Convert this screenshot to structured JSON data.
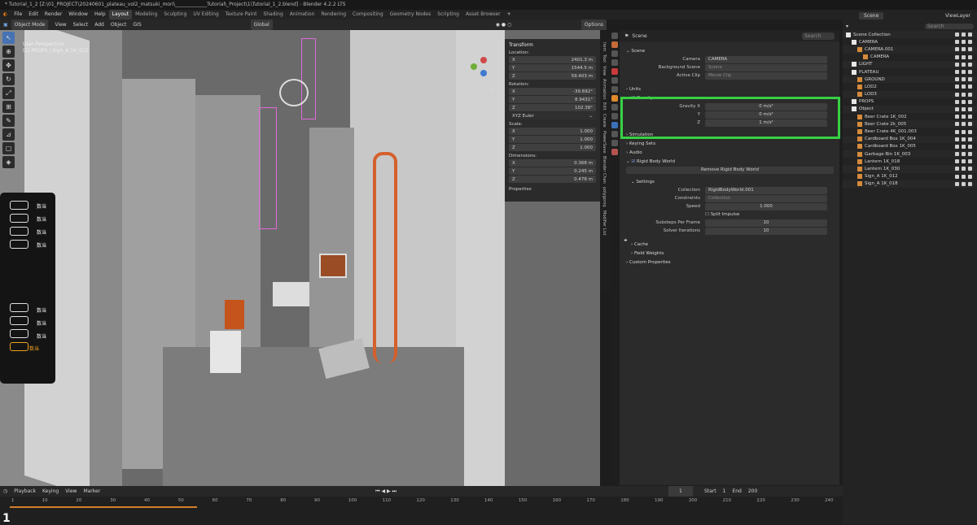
{
  "title": "* Tutorial_1_2 [Z:\\01_PROJECT\\20240601_plateau_vol2_matsuki_mori\\_____________Tutorial\\_Project\\1\\Tutorial_1_2.blend] - Blender 4.2.2 LTS",
  "menu": [
    "File",
    "Edit",
    "Render",
    "Window",
    "Help"
  ],
  "workspaces": [
    "Layout",
    "Modeling",
    "Sculpting",
    "UV Editing",
    "Texture Paint",
    "Shading",
    "Animation",
    "Rendering",
    "Compositing",
    "Geometry Nodes",
    "Scripting",
    "Asset Browser"
  ],
  "active_workspace": "Layout",
  "viewport_header": {
    "mode": "Object Mode",
    "items": [
      "View",
      "Select",
      "Add",
      "Object"
    ],
    "slot": "GIS",
    "orientation": "Global",
    "options": "Options"
  },
  "viewport": {
    "persp": "User Perspective",
    "selection": "(1) PROPS | Sign_A 1K_012"
  },
  "transform": {
    "title": "Transform",
    "location_label": "Location:",
    "location": [
      {
        "axis": "X",
        "value": "2401.3 m"
      },
      {
        "axis": "Y",
        "value": "1544.5 m"
      },
      {
        "axis": "Z",
        "value": "59.403 m"
      }
    ],
    "rotation_label": "Rotation:",
    "rotation": [
      {
        "axis": "X",
        "value": "-39.692°"
      },
      {
        "axis": "Y",
        "value": "8.9431°"
      },
      {
        "axis": "Z",
        "value": "102.38°"
      }
    ],
    "rotation_mode": "XYZ Euler",
    "scale_label": "Scale:",
    "scale": [
      {
        "axis": "X",
        "value": "1.000"
      },
      {
        "axis": "Y",
        "value": "1.000"
      },
      {
        "axis": "Z",
        "value": "1.000"
      }
    ],
    "dimensions_label": "Dimensions:",
    "dimensions": [
      {
        "axis": "X",
        "value": "0.368 m"
      },
      {
        "axis": "Y",
        "value": "0.245 m"
      },
      {
        "axis": "Z",
        "value": "0.478 m"
      }
    ],
    "properties": "Properties"
  },
  "ntabs": [
    "Item",
    "Tool",
    "View",
    "Animation",
    "Edit",
    "Create",
    "PowerSave",
    "Blender Chan",
    "polygoniq",
    "Modifier List"
  ],
  "overlay_labels": [
    "数当",
    "数当",
    "数当",
    "数当",
    "数当",
    "数当",
    "数当",
    "数当"
  ],
  "properties": {
    "search_placeholder": "Search",
    "scene": "Scene",
    "scene_section": "Scene",
    "camera_label": "Camera",
    "camera": "CAMERA",
    "bg_label": "Background Scene",
    "bg": "Scene",
    "clip_label": "Active Clip",
    "clip": "Movie Clip",
    "units": "Units",
    "gravity": "Gravity",
    "gx_label": "Gravity X",
    "gx": "0 m/s²",
    "gy_label": "Y",
    "gy": "0 m/s²",
    "gz_label": "Z",
    "gz": "1 m/s²",
    "simulation": "Simulation",
    "keying": "Keying Sets",
    "audio": "Audio",
    "rbw": "Rigid Body World",
    "remove_rbw": "Remove Rigid Body World",
    "settings": "Settings",
    "collection_label": "Collection",
    "collection": "RigidBodyWorld.001",
    "constraints_label": "Constraints",
    "constraints": "Collection",
    "speed_label": "Speed",
    "speed": "1.000",
    "split": "Split Impulse",
    "substeps_label": "Substeps Per Frame",
    "substeps": "10",
    "solver_label": "Solver Iterations",
    "solver": "10",
    "cache": "Cache",
    "field": "Field Weights",
    "custom": "Custom Properties"
  },
  "outliner": {
    "scene": "Scene",
    "viewlayer": "ViewLayer",
    "search": "Search",
    "rows": [
      {
        "indent": 0,
        "name": "Scene Collection"
      },
      {
        "indent": 1,
        "name": "CAMERA"
      },
      {
        "indent": 2,
        "name": "CAMERA.001"
      },
      {
        "indent": 3,
        "name": "CAMERA"
      },
      {
        "indent": 1,
        "name": "LIGHT"
      },
      {
        "indent": 1,
        "name": "PLATEAU"
      },
      {
        "indent": 2,
        "name": "GROUND"
      },
      {
        "indent": 2,
        "name": "LOD2"
      },
      {
        "indent": 2,
        "name": "LOD3"
      },
      {
        "indent": 1,
        "name": "PROPS"
      },
      {
        "indent": 1,
        "name": "Object"
      },
      {
        "indent": 2,
        "name": "Beer Crate 1K_002"
      },
      {
        "indent": 2,
        "name": "Beer Crate 2k_005"
      },
      {
        "indent": 2,
        "name": "Beer Crate 4K_001.003"
      },
      {
        "indent": 2,
        "name": "Cardboard Box 1K_004"
      },
      {
        "indent": 2,
        "name": "Cardboard Box 1K_005"
      },
      {
        "indent": 2,
        "name": "Garbage Bin 1K_003"
      },
      {
        "indent": 2,
        "name": "Lantern 1K_018"
      },
      {
        "indent": 2,
        "name": "Lantern 1K_030"
      },
      {
        "indent": 2,
        "name": "Sign_A 1K_012"
      },
      {
        "indent": 2,
        "name": "Sign_A 1K_018"
      }
    ]
  },
  "timeline": {
    "menus": [
      "Playback",
      "Keying",
      "View",
      "Marker"
    ],
    "current": "1",
    "start_label": "Start",
    "start": "1",
    "end_label": "End",
    "end": "200",
    "frame": "1",
    "ticks": [
      "1",
      "10",
      "20",
      "30",
      "40",
      "50",
      "60",
      "70",
      "80",
      "90",
      "100",
      "110",
      "120",
      "130",
      "140",
      "150",
      "160",
      "170",
      "180",
      "190",
      "200",
      "210",
      "220",
      "230",
      "240"
    ]
  }
}
